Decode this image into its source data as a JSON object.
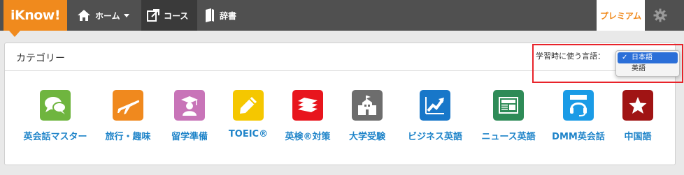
{
  "header": {
    "logo": "iKnow!",
    "nav": [
      {
        "label": "ホーム",
        "icon": "home-icon"
      },
      {
        "label": "コース",
        "icon": "course-icon"
      },
      {
        "label": "辞書",
        "icon": "dictionary-icon"
      }
    ],
    "premium": "プレミアム",
    "settings_icon": "gear-icon"
  },
  "panel": {
    "title": "カテゴリー",
    "language_label": "学習時に使う言語：",
    "language_options": [
      {
        "label": "日本語",
        "selected": true
      },
      {
        "label": "英語",
        "selected": false
      }
    ]
  },
  "categories": [
    {
      "label": "英会話マスター",
      "icon": "speech-bubbles-icon",
      "color": "#6fb53f"
    },
    {
      "label": "旅行・趣味",
      "icon": "airplane-icon",
      "color": "#f0891e"
    },
    {
      "label": "留学準備",
      "icon": "graduate-icon",
      "color": "#c874b8"
    },
    {
      "label": "TOEIC®",
      "icon": "pencil-icon",
      "color": "#f5c700"
    },
    {
      "label": "英検®対策",
      "icon": "books-icon",
      "color": "#e8151d"
    },
    {
      "label": "大学受験",
      "icon": "school-building-icon",
      "color": "#6d6d6d"
    },
    {
      "label": "ビジネス英語",
      "icon": "growth-chart-icon",
      "color": "#1877c9"
    },
    {
      "label": "ニュース英語",
      "icon": "newspaper-icon",
      "color": "#2e8b57"
    },
    {
      "label": "DMM英会話",
      "icon": "headset-icon",
      "color": "#1a9be6"
    },
    {
      "label": "中国語",
      "icon": "star-icon",
      "color": "#a01414"
    }
  ],
  "colors": {
    "brand": "#f08a1d",
    "nav_bg": "#505050",
    "link": "#1f84c9",
    "highlight": "#e8232a"
  }
}
